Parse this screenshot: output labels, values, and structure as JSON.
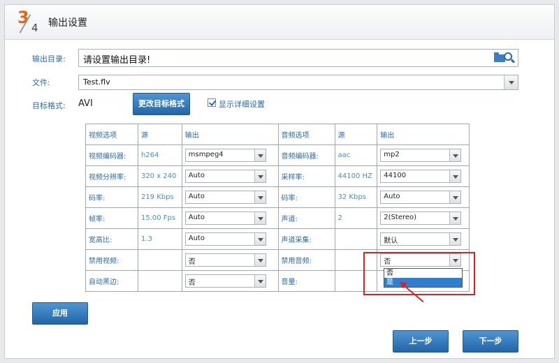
{
  "header": {
    "step_current": "3",
    "step_total": "4",
    "title": "输出设置"
  },
  "output_dir": {
    "label": "输出目录:",
    "value": "请设置输出目录!"
  },
  "file": {
    "label": "文件:",
    "value": "Test.flv"
  },
  "format": {
    "label": "目标格式:",
    "value": "AVI",
    "change_button": "更改目标格式",
    "show_details_checked": true,
    "show_details_label": "显示详细设置"
  },
  "table": {
    "headers": {
      "video_option": "视频选项",
      "source1": "源",
      "output1": "输出",
      "audio_option": "音频选项",
      "source2": "源",
      "output2": "输出"
    },
    "rows": [
      {
        "vlabel": "视频编码器:",
        "vsrc": "h264",
        "vout": "msmpeg4",
        "alabel": "音频编码器:",
        "asrc": "aac",
        "aout": "mp2"
      },
      {
        "vlabel": "视频分辨率:",
        "vsrc": "320 x 240",
        "vout": "Auto",
        "alabel": "采样率:",
        "asrc": "44100 HZ",
        "aout": "44100"
      },
      {
        "vlabel": "码率:",
        "vsrc": "219 Kbps",
        "vout": "Auto",
        "alabel": "码率:",
        "asrc": "32 Kbps",
        "aout": "Auto"
      },
      {
        "vlabel": "帧率:",
        "vsrc": "15.00 Fps",
        "vout": "Auto",
        "alabel": "声道:",
        "asrc": "2",
        "aout": "2(Stereo)"
      },
      {
        "vlabel": "宽高比:",
        "vsrc": "1.3",
        "vout": "Auto",
        "alabel": "声道采集:",
        "asrc": "",
        "aout": "默认"
      },
      {
        "vlabel": "禁用视频:",
        "vsrc": "",
        "vout": "否",
        "alabel": "禁用音频:",
        "asrc": "",
        "aout": "否"
      },
      {
        "vlabel": "自动黑边:",
        "vsrc": "",
        "vout": "否",
        "alabel": "音量:",
        "asrc": "",
        "aout": ""
      }
    ]
  },
  "dropdown_open": {
    "options": [
      "否",
      "是"
    ],
    "selected_index": 1
  },
  "annotation_color": "#e02020",
  "buttons": {
    "apply": "应用",
    "prev": "上一步",
    "next": "下一步"
  }
}
